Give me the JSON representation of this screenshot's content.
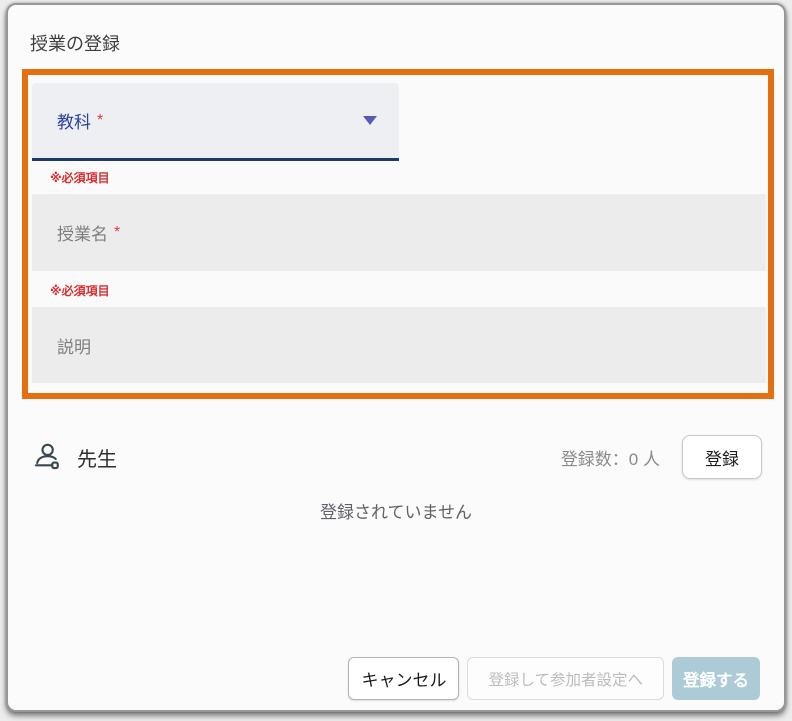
{
  "dialog": {
    "title": "授業の登録",
    "form": {
      "subject": {
        "label": "教科",
        "required_mark": "*",
        "helper": "※必須項目"
      },
      "class_name": {
        "placeholder": "授業名",
        "required_mark": "*",
        "helper": "※必須項目"
      },
      "description": {
        "placeholder": "説明"
      }
    },
    "teacher_section": {
      "title": "先生",
      "count_label": "登録数：0 人",
      "registered_count": 0,
      "register_button": "登録",
      "empty_message": "登録されていません"
    },
    "footer": {
      "cancel_button": "キャンセル",
      "register_and_setup_button": "登録して参加者設定へ",
      "submit_button": "登録する"
    },
    "colors": {
      "highlight_border": "#e56e0e",
      "select_underline": "#1c3a6e",
      "accent_indigo": "#2b3f9e",
      "required_red": "#d93030",
      "submit_disabled_bg": "#accbd7"
    }
  }
}
